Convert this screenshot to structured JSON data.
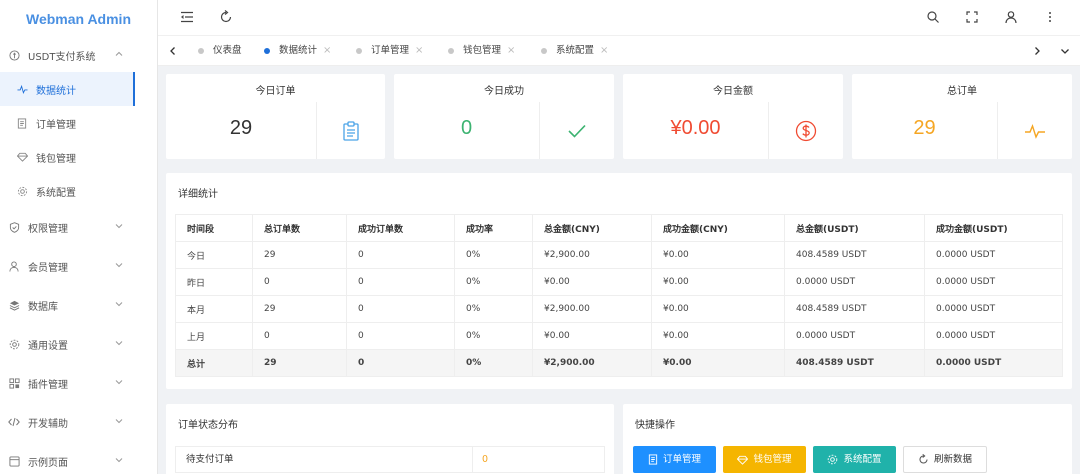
{
  "app": {
    "title": "Webman Admin"
  },
  "sidebar": {
    "items": [
      {
        "label": "USDT支付系统",
        "icon": "usdt-icon",
        "children": [
          {
            "label": "数据统计",
            "icon": "pulse-icon"
          },
          {
            "label": "订单管理",
            "icon": "document-icon"
          },
          {
            "label": "钱包管理",
            "icon": "diamond-icon"
          },
          {
            "label": "系统配置",
            "icon": "gear-icon"
          }
        ]
      },
      {
        "label": "权限管理",
        "icon": "shield-check-icon"
      },
      {
        "label": "会员管理",
        "icon": "user-icon"
      },
      {
        "label": "数据库",
        "icon": "database-icon"
      },
      {
        "label": "通用设置",
        "icon": "settings-icon"
      },
      {
        "label": "插件管理",
        "icon": "plugin-icon"
      },
      {
        "label": "开发辅助",
        "icon": "code-icon"
      },
      {
        "label": "示例页面",
        "icon": "page-icon"
      }
    ]
  },
  "topbar": {
    "icons": [
      "menu-fold-icon",
      "refresh-icon",
      "search-icon",
      "fullscreen-icon",
      "user-icon",
      "more-vertical-icon"
    ]
  },
  "tabs": [
    {
      "label": "仪表盘",
      "closable": false,
      "active": false
    },
    {
      "label": "数据统计",
      "closable": true,
      "active": true
    },
    {
      "label": "订单管理",
      "closable": true,
      "active": false
    },
    {
      "label": "钱包管理",
      "closable": true,
      "active": false
    },
    {
      "label": "系统配置",
      "closable": true,
      "active": false
    }
  ],
  "stats": [
    {
      "title": "今日订单",
      "value": "29",
      "color": "#333333",
      "icon": "clipboard-icon",
      "icon_color": "#4aa3e8"
    },
    {
      "title": "今日成功",
      "value": "0",
      "color": "#3cb371",
      "icon": "check-icon",
      "icon_color": "#3cb371"
    },
    {
      "title": "今日金额",
      "value": "¥0.00",
      "color": "#f04b32",
      "icon": "dollar-icon",
      "icon_color": "#f04b32"
    },
    {
      "title": "总订单",
      "value": "29",
      "color": "#f5a623",
      "icon": "pulse-icon",
      "icon_color": "#f5a623"
    }
  ],
  "detail": {
    "title": "详细统计",
    "columns": [
      "时间段",
      "总订单数",
      "成功订单数",
      "成功率",
      "总金额(CNY)",
      "成功金额(CNY)",
      "总金额(USDT)",
      "成功金额(USDT)"
    ],
    "rows": [
      [
        "今日",
        "29",
        "0",
        "0%",
        "¥2,900.00",
        "¥0.00",
        "408.4589 USDT",
        "0.0000 USDT"
      ],
      [
        "昨日",
        "0",
        "0",
        "0%",
        "¥0.00",
        "¥0.00",
        "0.0000 USDT",
        "0.0000 USDT"
      ],
      [
        "本月",
        "29",
        "0",
        "0%",
        "¥2,900.00",
        "¥0.00",
        "408.4589 USDT",
        "0.0000 USDT"
      ],
      [
        "上月",
        "0",
        "0",
        "0%",
        "¥0.00",
        "¥0.00",
        "0.0000 USDT",
        "0.0000 USDT"
      ],
      [
        "总计",
        "29",
        "0",
        "0%",
        "¥2,900.00",
        "¥0.00",
        "408.4589 USDT",
        "0.0000 USDT"
      ]
    ]
  },
  "status_dist": {
    "title": "订单状态分布",
    "rows": [
      {
        "label": "待支付订单",
        "value": "0"
      }
    ]
  },
  "quick": {
    "title": "快捷操作",
    "buttons": [
      {
        "label": "订单管理",
        "icon": "document-icon",
        "color": "#1e90ff"
      },
      {
        "label": "钱包管理",
        "icon": "diamond-icon",
        "color": "#f5b500"
      },
      {
        "label": "系统配置",
        "icon": "gear-icon",
        "color": "#20b2aa"
      },
      {
        "label": "刷新数据",
        "icon": "refresh-icon",
        "color": "#ffffff"
      }
    ]
  }
}
